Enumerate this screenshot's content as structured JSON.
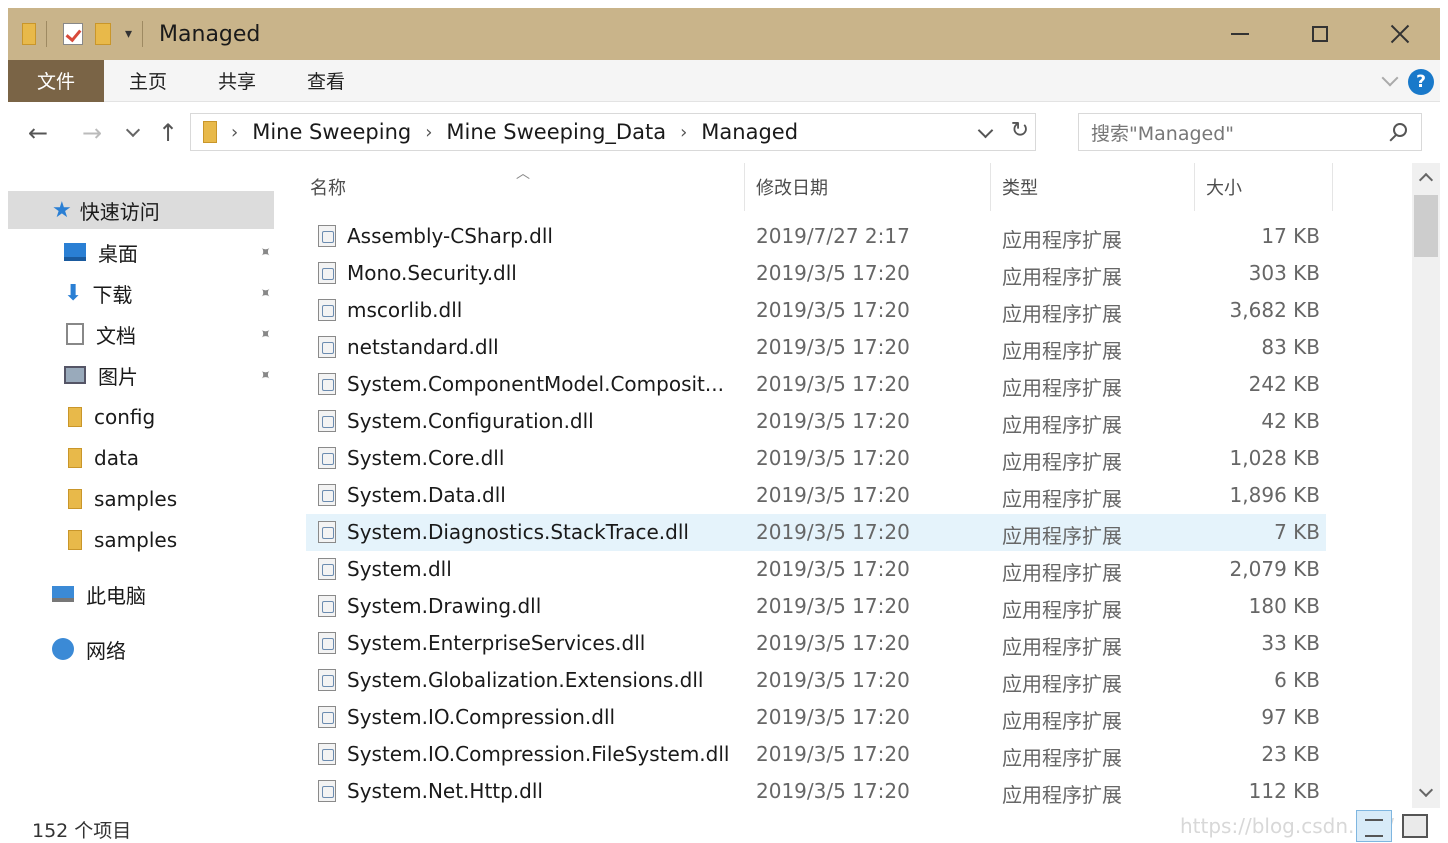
{
  "window": {
    "title": "Managed"
  },
  "ribbon": {
    "tabs": [
      "文件",
      "主页",
      "共享",
      "查看"
    ]
  },
  "address": {
    "breadcrumbs": [
      "Mine Sweeping",
      "Mine Sweeping_Data",
      "Managed"
    ],
    "search_placeholder": "搜索\"Managed\""
  },
  "sidebar": {
    "quick_access": "快速访问",
    "items": [
      {
        "label": "桌面",
        "icon": "desktop-icon",
        "pinned": true
      },
      {
        "label": "下载",
        "icon": "download-icon",
        "pinned": true
      },
      {
        "label": "文档",
        "icon": "document-icon",
        "pinned": true
      },
      {
        "label": "图片",
        "icon": "picture-icon",
        "pinned": true
      },
      {
        "label": "config",
        "icon": "folder-icon",
        "pinned": false
      },
      {
        "label": "data",
        "icon": "folder-icon",
        "pinned": false
      },
      {
        "label": "samples",
        "icon": "folder-icon",
        "pinned": false
      },
      {
        "label": "samples",
        "icon": "folder-icon",
        "pinned": false
      }
    ],
    "this_pc": "此电脑",
    "network": "网络"
  },
  "columns": {
    "name": "名称",
    "date": "修改日期",
    "type": "类型",
    "size": "大小"
  },
  "files": [
    {
      "name": "Assembly-CSharp.dll",
      "date": "2019/7/27 2:17",
      "type": "应用程序扩展",
      "size": "17 KB"
    },
    {
      "name": "Mono.Security.dll",
      "date": "2019/3/5 17:20",
      "type": "应用程序扩展",
      "size": "303 KB"
    },
    {
      "name": "mscorlib.dll",
      "date": "2019/3/5 17:20",
      "type": "应用程序扩展",
      "size": "3,682 KB"
    },
    {
      "name": "netstandard.dll",
      "date": "2019/3/5 17:20",
      "type": "应用程序扩展",
      "size": "83 KB"
    },
    {
      "name": "System.ComponentModel.Composit...",
      "date": "2019/3/5 17:20",
      "type": "应用程序扩展",
      "size": "242 KB"
    },
    {
      "name": "System.Configuration.dll",
      "date": "2019/3/5 17:20",
      "type": "应用程序扩展",
      "size": "42 KB"
    },
    {
      "name": "System.Core.dll",
      "date": "2019/3/5 17:20",
      "type": "应用程序扩展",
      "size": "1,028 KB"
    },
    {
      "name": "System.Data.dll",
      "date": "2019/3/5 17:20",
      "type": "应用程序扩展",
      "size": "1,896 KB"
    },
    {
      "name": "System.Diagnostics.StackTrace.dll",
      "date": "2019/3/5 17:20",
      "type": "应用程序扩展",
      "size": "7 KB"
    },
    {
      "name": "System.dll",
      "date": "2019/3/5 17:20",
      "type": "应用程序扩展",
      "size": "2,079 KB"
    },
    {
      "name": "System.Drawing.dll",
      "date": "2019/3/5 17:20",
      "type": "应用程序扩展",
      "size": "180 KB"
    },
    {
      "name": "System.EnterpriseServices.dll",
      "date": "2019/3/5 17:20",
      "type": "应用程序扩展",
      "size": "33 KB"
    },
    {
      "name": "System.Globalization.Extensions.dll",
      "date": "2019/3/5 17:20",
      "type": "应用程序扩展",
      "size": "6 KB"
    },
    {
      "name": "System.IO.Compression.dll",
      "date": "2019/3/5 17:20",
      "type": "应用程序扩展",
      "size": "97 KB"
    },
    {
      "name": "System.IO.Compression.FileSystem.dll",
      "date": "2019/3/5 17:20",
      "type": "应用程序扩展",
      "size": "23 KB"
    },
    {
      "name": "System.Net.Http.dll",
      "date": "2019/3/5 17:20",
      "type": "应用程序扩展",
      "size": "112 KB"
    }
  ],
  "status": {
    "item_count": "152 个项目",
    "watermark": "https://blog.csdn.net/"
  },
  "colors": {
    "titlebar": "#c9b48a",
    "file_tab": "#7a6446",
    "hover_row": "#e5f3fb",
    "accent": "#1979ca"
  }
}
